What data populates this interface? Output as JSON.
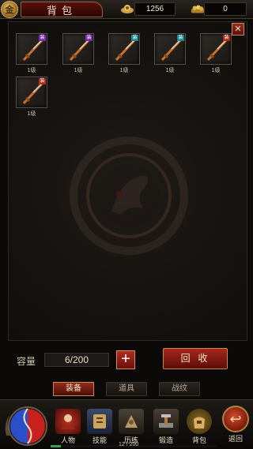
{
  "header": {
    "title": "背包",
    "avatar_glyph": "金",
    "resource1": {
      "icon": "ingot-icon",
      "value": "1256"
    },
    "resource2": {
      "icon": "gold-pile-icon",
      "value": "0"
    }
  },
  "inventory": {
    "items": [
      {
        "name": "sword",
        "tag": "装",
        "tag_color": "purple",
        "level": "1级"
      },
      {
        "name": "sword",
        "tag": "装",
        "tag_color": "purple",
        "level": "1级"
      },
      {
        "name": "sword",
        "tag": "装",
        "tag_color": "teal",
        "level": "1级"
      },
      {
        "name": "sword",
        "tag": "装",
        "tag_color": "teal",
        "level": "1级"
      },
      {
        "name": "sword",
        "tag": "装",
        "tag_color": "red",
        "level": "1级"
      },
      {
        "name": "sword",
        "tag": "装",
        "tag_color": "red",
        "level": "1级"
      }
    ]
  },
  "capacity": {
    "label": "容量",
    "value": "6/200"
  },
  "buttons": {
    "recycle": "回 收",
    "close": "✕",
    "plus": "+"
  },
  "tabs": [
    {
      "label": "装备",
      "active": true
    },
    {
      "label": "道具",
      "active": false
    },
    {
      "label": "战纹",
      "active": false
    }
  ],
  "nav": [
    {
      "label": "人物",
      "icon": "character-icon"
    },
    {
      "label": "技能",
      "icon": "skill-icon"
    },
    {
      "label": "历练",
      "icon": "training-icon"
    },
    {
      "label": "锻造",
      "icon": "forge-icon"
    },
    {
      "label": "背包",
      "icon": "bag-icon"
    }
  ],
  "back": {
    "label": "返回",
    "glyph": "↩"
  },
  "exp": {
    "text": "12 / 200",
    "fraction": 0.06
  },
  "colors": {
    "accent_red": "#a8261c",
    "gold": "#c8894f",
    "exp_green": "#3aa04a"
  }
}
